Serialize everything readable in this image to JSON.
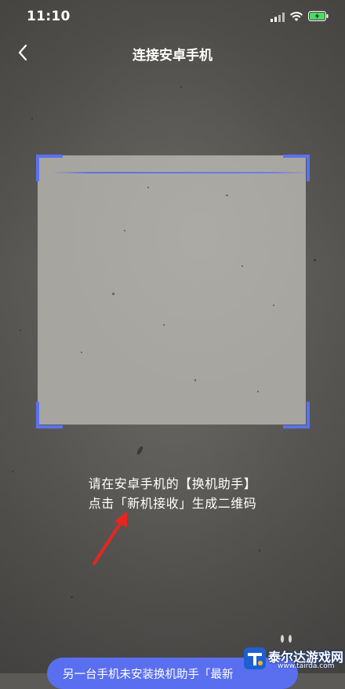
{
  "status_bar": {
    "time": "11:10",
    "icons": [
      "signal-icon",
      "wifi-icon",
      "battery-charging-icon"
    ]
  },
  "nav": {
    "back_icon": "chevron-left-icon",
    "title": "连接安卓手机"
  },
  "scanner": {
    "accent_color": "#5a72f0"
  },
  "hint": {
    "line1": "请在安卓手机的【换机助手】",
    "line2": "点击「新机接收」生成二维码"
  },
  "annotation": {
    "arrow_color": "#e8251f"
  },
  "bottom_banner": {
    "text": "另一台手机未安装换机助手「最新"
  },
  "watermark": {
    "name": "泰尔达游戏网",
    "url": "www.tairda.com"
  }
}
